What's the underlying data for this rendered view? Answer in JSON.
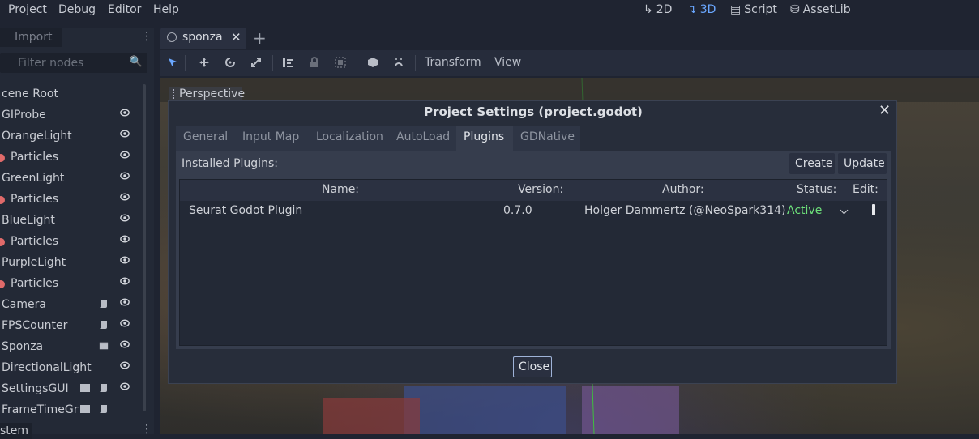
{
  "menubar": {
    "items": [
      "Project",
      "Debug",
      "Editor",
      "Help"
    ],
    "modes": [
      "2D",
      "3D",
      "Script",
      "AssetLib"
    ],
    "active_mode": "3D"
  },
  "left_dock": {
    "tab_import": "Import",
    "filter_placeholder": "Filter nodes",
    "nodes": [
      {
        "label": "cene Root"
      },
      {
        "label": "GIProbe"
      },
      {
        "label": "OrangeLight"
      },
      {
        "label": "Particles"
      },
      {
        "label": "GreenLight"
      },
      {
        "label": "Particles"
      },
      {
        "label": "BlueLight"
      },
      {
        "label": "Particles"
      },
      {
        "label": "PurpleLight"
      },
      {
        "label": "Particles"
      },
      {
        "label": "Camera"
      },
      {
        "label": "FPSCounter"
      },
      {
        "label": "Sponza"
      },
      {
        "label": "DirectionalLight"
      },
      {
        "label": "SettingsGUI"
      },
      {
        "label": "FrameTimeGr"
      }
    ],
    "bottom_tab": "stem"
  },
  "scene_tabs": {
    "current": "sponza"
  },
  "toolbar": {
    "transform_label": "Transform",
    "view_label": "View"
  },
  "viewport": {
    "perspective_label": "Perspective"
  },
  "dialog": {
    "title": "Project Settings (project.godot)",
    "tabs": [
      "General",
      "Input Map",
      "Localization",
      "AutoLoad",
      "Plugins",
      "GDNative"
    ],
    "active_tab": "Plugins",
    "installed_label": "Installed Plugins:",
    "create_label": "Create",
    "update_label": "Update",
    "columns": {
      "name": "Name:",
      "version": "Version:",
      "author": "Author:",
      "status": "Status:",
      "edit": "Edit:"
    },
    "plugins": [
      {
        "name": "Seurat Godot Plugin",
        "version": "0.7.0",
        "author": "Holger Dammertz (@NeoSpark314)",
        "status": "Active"
      }
    ],
    "close_label": "Close"
  },
  "colors": {
    "accent": "#6aa7ff",
    "active_status": "#6de07a",
    "particles_icon": "#e06a6a"
  }
}
